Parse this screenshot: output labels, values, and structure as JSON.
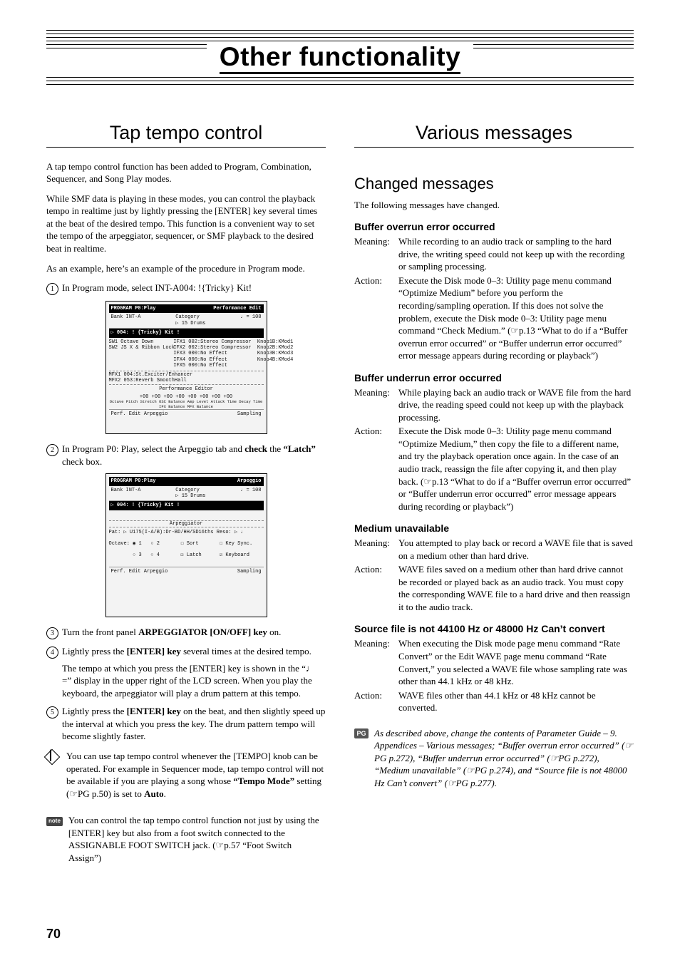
{
  "banner": "Other functionality",
  "page_number": "70",
  "left": {
    "heading": "Tap tempo control",
    "intro1": "A tap tempo control function has been added to Program, Combination, Sequencer, and Song Play modes.",
    "intro2": "While SMF data is playing in these modes, you can control the playback tempo in realtime just by lightly pressing the [ENTER] key several times at the beat of the desired tempo. This function is a convenient way to set the tempo of the arpeggiator, sequencer, or SMF playback to the desired beat in realtime.",
    "intro3": "As an example, here’s an example of the procedure in Program mode.",
    "steps": [
      {
        "n": "1",
        "text": "In Program mode, select INT-A004: !{Tricky} Kit!"
      },
      {
        "n": "2",
        "text_a": "In Program P0: Play, select the Arpeggio tab and ",
        "bold1": "check",
        "text_b": " the ",
        "bold2": "“Latch”",
        "text_c": " check box."
      },
      {
        "n": "3",
        "text_a": "Turn the front panel ",
        "bold1": "ARPEGGIATOR [ON/OFF] key",
        "text_b": " on."
      },
      {
        "n": "4",
        "text_a": "Lightly press the ",
        "bold1": "[ENTER] key",
        "text_b": " several times at the desired tempo.",
        "cont": "The tempo at which you press the [ENTER] key is shown in the “♩ =” display in the upper right of the LCD screen. When you play the keyboard, the arpeggiator will play a drum pattern at this tempo."
      },
      {
        "n": "5",
        "text_a": "Lightly press the ",
        "bold1": "[ENTER] key",
        "text_b": " on the beat, and then slightly speed up the interval at which you press the key. The drum pattern tempo will become slightly faster."
      }
    ],
    "tip1_a": "You can use tap tempo control whenever the [TEMPO] knob can be operated. For example in Sequencer mode, tap tempo control will not be available if you are playing a song whose ",
    "tip1_bold1": "“Tempo Mode”",
    "tip1_b": " setting (☞PG p.50) is set to ",
    "tip1_bold2": "Auto",
    "tip1_c": ".",
    "tip2": "You can control the tap tempo control function not just by using the [ENTER] key but also from a foot switch connected to the ASSIGNABLE FOOT SWITCH jack. (☞p.57 “Foot Switch Assign”)",
    "shot1": {
      "title_l": "PROGRAM P0:Play",
      "title_r": "Performance Edit",
      "bank": "Bank INT-A",
      "cat": "Category\n▷ 15 Drums",
      "tempo": "♩ = 108",
      "prog": "▷ 004: ! {Tricky} Kit !",
      "sw": "SW1 Octave Down\nSW2 JS X & Ribbon Lock",
      "ifx": "IFX1 002:Stereo Compressor  Knob1B:KMod1\nIFX2 002:Stereo Compressor  Knob2B:KMod2\nIFX3 000:No Effect          Knob3B:KMod3\nIFX4 000:No Effect          Knob4B:KMod4\nIFX5 000:No Effect",
      "mfx": "MFX1 004:St.Exciter/Enhancer\nMFX2 053:Reverb SmoothHall",
      "perf": "Performance Editor",
      "vals": "+00  +00  +00  +00  +00  +00  +00  +00",
      "labels": "Octave  Pitch Stretch  OSC Balance  Amp Level  Attack Time  Decay Time  IFX Balance  MFX Balance",
      "tabs_l": "Perf. Edit   Arpeggio",
      "tabs_r": "Sampling"
    },
    "shot2": {
      "title_l": "PROGRAM P0:Play",
      "title_r": "Arpeggio",
      "bank": "Bank INT-A",
      "cat": "Category\n▷ 15 Drums",
      "tempo": "♩ = 108",
      "prog": "▷ 004: ! {Tricky} Kit !",
      "arp": "Arpeggiator",
      "pat": "Pat: ▷ U175(I-A/B):Dr-BD/HH/SD16ths   Reso: ▷ ♩",
      "oct": "Octave: ◉ 1   ○ 2       ☐ Sort       ☐ Key Sync.",
      "oct2": "        ○ 3   ○ 4       ☑ Latch      ☑ Keyboard",
      "tabs_l": "Perf. Edit   Arpeggio",
      "tabs_r": "Sampling"
    }
  },
  "right": {
    "heading": "Various messages",
    "sub": "Changed messages",
    "intro": "The following messages have changed.",
    "items": [
      {
        "title": "Buffer overrun error occurred",
        "meaning": "While recording to an audio track or sampling to the hard drive, the writing speed could not keep up with the recording or sampling processing.",
        "action": "Execute the Disk mode 0–3: Utility page menu command “Optimize Medium” before you perform the recording/sampling operation. If this does not solve the problem, execute the Disk mode 0–3: Utility page menu command “Check Medium.” (☞p.13 “What to do if a “Buffer overrun error occurred” or “Buffer underrun error occurred” error message appears during recording or playback”)"
      },
      {
        "title": "Buffer underrun error occurred",
        "meaning": "While playing back an audio track or WAVE file from the hard drive, the reading speed could not keep up with the playback processing.",
        "action": "Execute the Disk mode 0–3: Utility page menu command “Optimize Medium,” then copy the file to a different name, and try the playback operation once again. In the case of an audio track, reassign the file after copying it, and then play back. (☞p.13 “What to do if a “Buffer overrun error occurred” or “Buffer underrun error occurred” error message appears during recording or playback”)"
      },
      {
        "title": "Medium unavailable",
        "meaning": "You attempted to play back or record a WAVE file that is saved on a medium other than hard drive.",
        "action": "WAVE files saved on a medium other than hard drive cannot be recorded or played back as an audio track. You must copy the corresponding WAVE file to a hard drive and then reassign it to the audio track."
      },
      {
        "title": "Source file is not 44100 Hz or 48000 Hz Can’t convert",
        "meaning": "When executing the Disk mode page menu command “Rate Convert” or the Edit WAVE page menu command “Rate Convert,” you selected a WAVE file whose sampling rate was other than 44.1 kHz or 48 kHz.",
        "action": "WAVE files other than 44.1 kHz or 48 kHz cannot be converted."
      }
    ],
    "pg_note": "As described above, change the contents of Parameter Guide – 9. Appendices – Various messages; “Buffer overrun error occurred” (☞PG p.272), “Buffer underrun error occurred” (☞PG p.272), “Medium unavailable” (☞PG p.274), and “Source file is not 48000 Hz Can’t convert” (☞PG p.277)."
  }
}
